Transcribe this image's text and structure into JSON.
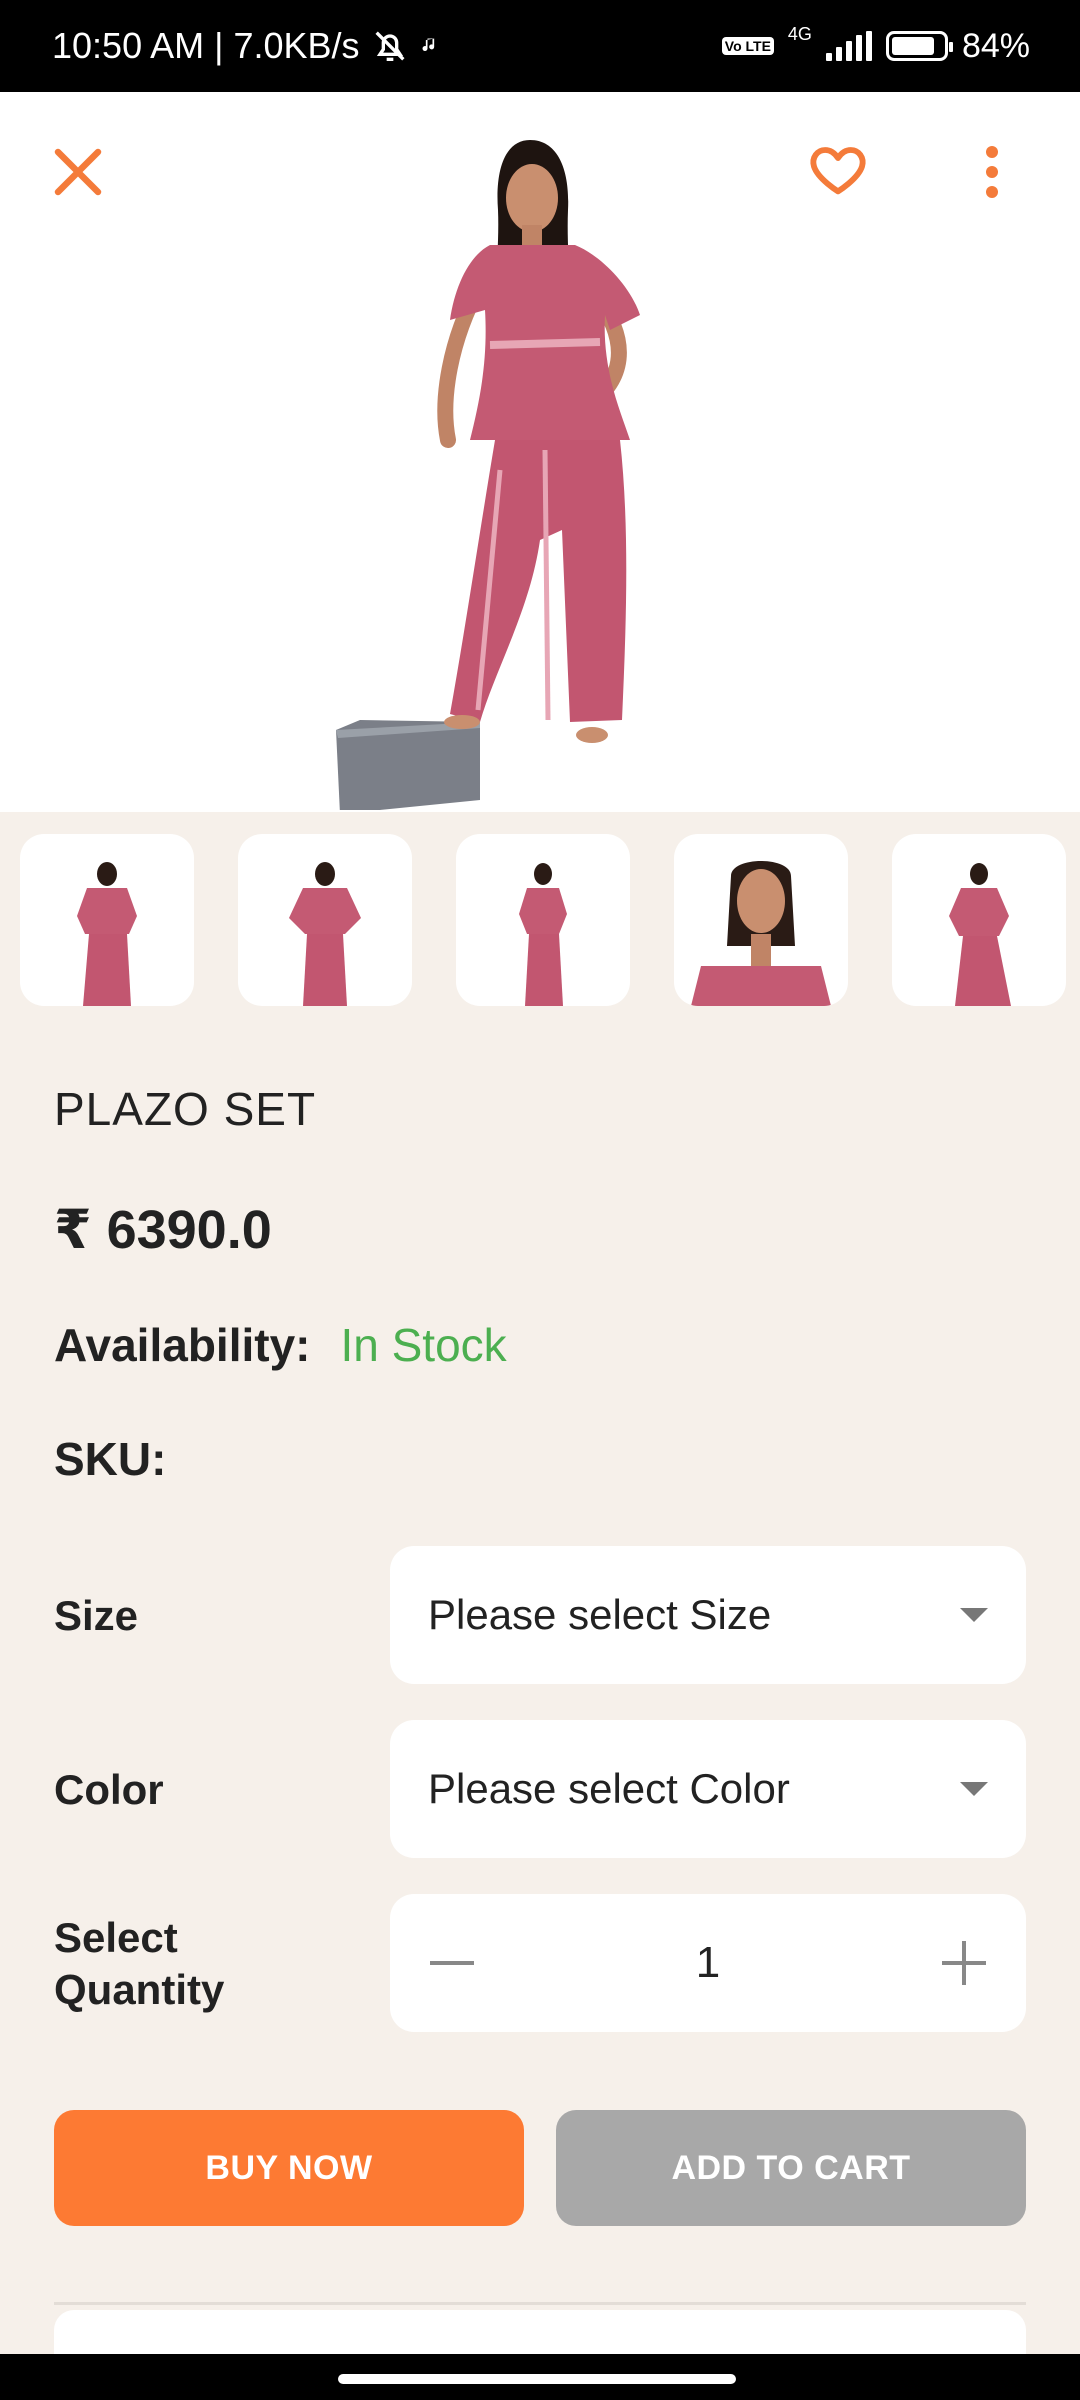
{
  "status_bar": {
    "time_speed": "10:50 AM | 7.0KB/s",
    "network": "4G",
    "volte": "Vo LTE",
    "battery": "84%",
    "battery_level": 0.84
  },
  "header": {
    "close_icon": "close-icon",
    "wishlist_icon": "heart-icon",
    "more_icon": "more-vertical-icon",
    "accent_color": "#f47b3a"
  },
  "product": {
    "name": "PLAZO SET",
    "price": "₹ 6390.0",
    "availability_label": "Availability:",
    "availability_value": "In Stock",
    "sku_label": "SKU:",
    "thumbnail_count": 5
  },
  "options": {
    "size_label": "Size",
    "size_placeholder": "Please select Size",
    "color_label": "Color",
    "color_placeholder": "Please select Color",
    "quantity_label_line1": "Select",
    "quantity_label_line2": "Quantity",
    "quantity_value": "1"
  },
  "actions": {
    "buy_now": "BUY NOW",
    "add_to_cart": "ADD TO CART",
    "buy_color": "#fd7a33",
    "cart_color": "#a8a8a8"
  }
}
